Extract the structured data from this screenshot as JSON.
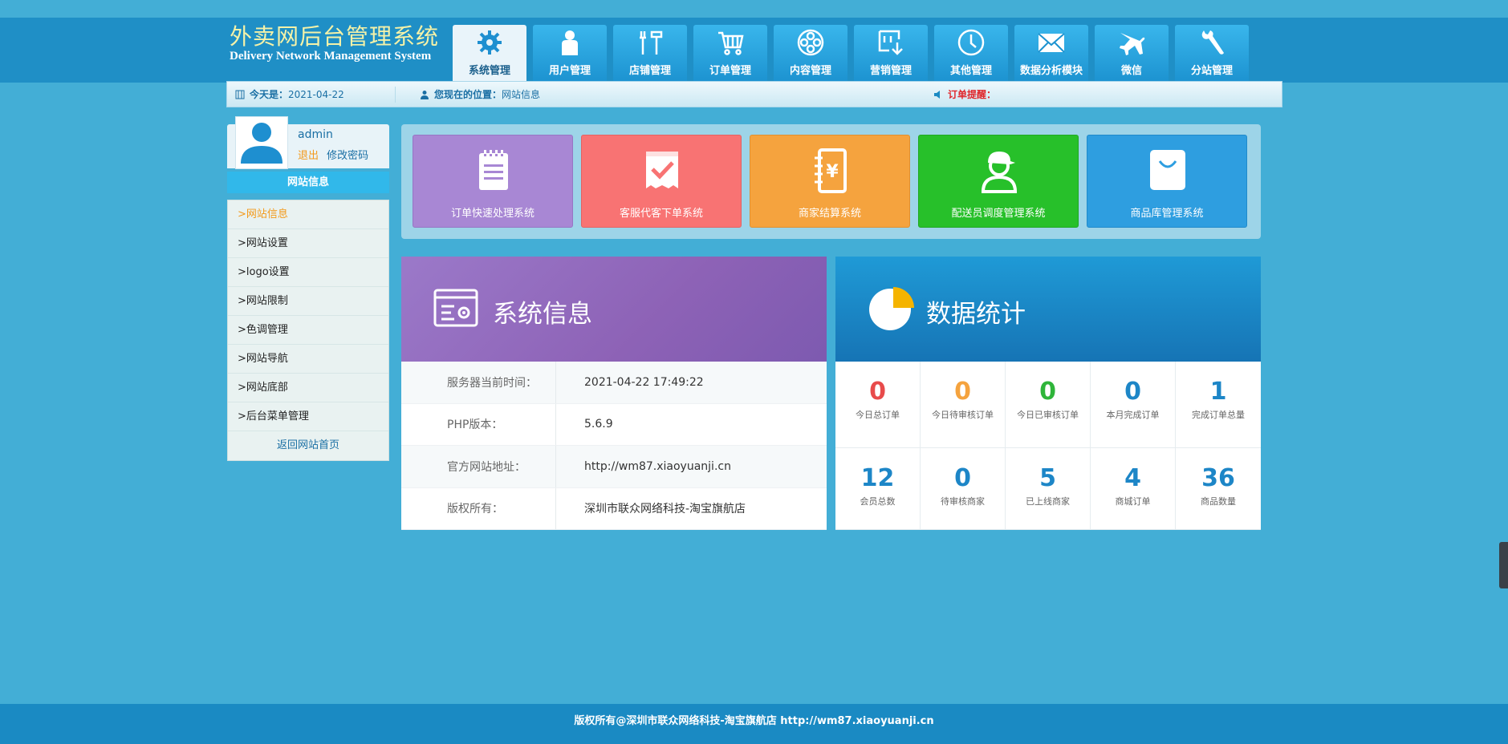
{
  "header": {
    "logo_cn": "外卖网后台管理系统",
    "logo_en": "Delivery Network Management System",
    "nav": [
      {
        "label": "系统管理",
        "icon": "gear-icon",
        "active": true
      },
      {
        "label": "用户管理",
        "icon": "user-icon",
        "active": false
      },
      {
        "label": "店铺管理",
        "icon": "tools-icon",
        "active": false
      },
      {
        "label": "订单管理",
        "icon": "cart-icon",
        "active": false
      },
      {
        "label": "内容管理",
        "icon": "film-reel-icon",
        "active": false
      },
      {
        "label": "营销管理",
        "icon": "box-arrow-icon",
        "active": false
      },
      {
        "label": "其他管理",
        "icon": "clock-icon",
        "active": false
      },
      {
        "label": "数据分析模块",
        "icon": "envelope-icon",
        "active": false
      },
      {
        "label": "微信",
        "icon": "plane-icon",
        "active": false
      },
      {
        "label": "分站管理",
        "icon": "wrench-icon",
        "active": false
      }
    ]
  },
  "infobar": {
    "date_label": "今天是：",
    "date_value": "2021-04-22",
    "position_label": "您现在的位置：",
    "position_value": "网站信息",
    "order_label": "订单提醒："
  },
  "sidebar": {
    "username": "admin",
    "logout": "退出",
    "change_password": "修改密码",
    "section_title": "网站信息",
    "items": [
      {
        "label": ">网站信息",
        "active": true
      },
      {
        "label": ">网站设置",
        "active": false
      },
      {
        "label": ">logo设置",
        "active": false
      },
      {
        "label": ">网站限制",
        "active": false
      },
      {
        "label": ">色调管理",
        "active": false
      },
      {
        "label": ">网站导航",
        "active": false
      },
      {
        "label": ">网站底部",
        "active": false
      },
      {
        "label": ">后台菜单管理",
        "active": false
      }
    ],
    "back_home": "返回网站首页"
  },
  "tiles": [
    {
      "label": "订单快速处理系统",
      "color": "#a887d4",
      "icon": "clipboard-list-icon"
    },
    {
      "label": "客服代客下单系统",
      "color": "#f87373",
      "icon": "receipt-check-icon"
    },
    {
      "label": "商家结算系统",
      "color": "#f5a33e",
      "icon": "notebook-yen-icon"
    },
    {
      "label": "配送员调度管理系统",
      "color": "#27c02a",
      "icon": "courier-icon"
    },
    {
      "label": "商品库管理系统",
      "color": "#2e9ee0",
      "icon": "shopping-bag-icon"
    }
  ],
  "system_info": {
    "title": "系统信息",
    "rows": [
      {
        "key": "服务器当前时间：",
        "value": "2021-04-22 17:49:22"
      },
      {
        "key": "PHP版本：",
        "value": "5.6.9"
      },
      {
        "key": "官方网站地址：",
        "value": "http://wm87.xiaoyuanji.cn"
      },
      {
        "key": "版权所有：",
        "value": "深圳市联众网络科技-淘宝旗航店"
      }
    ]
  },
  "stats": {
    "title": "数据统计",
    "cells": [
      {
        "value": "0",
        "label": "今日总订单",
        "color": "#e84b4b"
      },
      {
        "value": "0",
        "label": "今日待审核订单",
        "color": "#f5a33e"
      },
      {
        "value": "0",
        "label": "今日已审核订单",
        "color": "#2fb53a"
      },
      {
        "value": "0",
        "label": "本月完成订单",
        "color": "#1d86c7"
      },
      {
        "value": "1",
        "label": "完成订单总量",
        "color": "#1d86c7"
      },
      {
        "value": "12",
        "label": "会员总数",
        "color": "#1d86c7"
      },
      {
        "value": "0",
        "label": "待审核商家",
        "color": "#1d86c7"
      },
      {
        "value": "5",
        "label": "已上线商家",
        "color": "#1d86c7"
      },
      {
        "value": "4",
        "label": "商城订单",
        "color": "#1d86c7"
      },
      {
        "value": "36",
        "label": "商品数量",
        "color": "#1d86c7"
      }
    ]
  },
  "footer": {
    "text": "版权所有@深圳市联众网络科技-淘宝旗航店 http://wm87.xiaoyuanji.cn"
  }
}
